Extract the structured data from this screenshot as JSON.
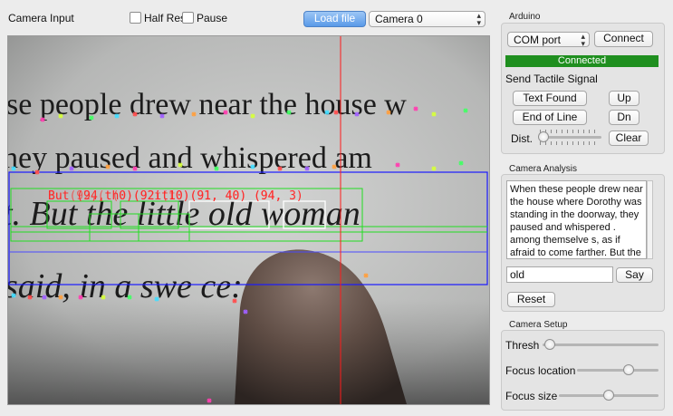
{
  "camera_input": {
    "title": "Camera Input",
    "half_res": "Half Res",
    "pause": "Pause",
    "load_file": "Load file",
    "camera_select": "Camera 0",
    "overlay": {
      "text_line_1": "But (94,th0)(92it10)(91, 40) (94, 3)",
      "text_line_2": "But(92,(t(0)(92t(t0)(91, 40)   (94,",
      "marker_colors": [
        "#ff3fb0",
        "#d6ff3c",
        "#44ff66",
        "#44ddff",
        "#ff4f4f",
        "#a060ff",
        "#ffa040"
      ]
    }
  },
  "arduino": {
    "title": "Arduino",
    "port_select": "COM port",
    "connect": "Connect",
    "status": "Connected",
    "status_color": "#1f8f1f",
    "send_label": "Send Tactile Signal",
    "text_found": "Text Found",
    "up": "Up",
    "end_of_line": "End of Line",
    "dn": "Dn",
    "dist_label": "Dist.",
    "dist_value": 0.0,
    "clear": "Clear"
  },
  "camera_analysis": {
    "title": "Camera Analysis",
    "text": "When these people drew near the house where Dorothy was standing in the doorway, they paused and whispered . among themselve s, as if afraid to come farther. But the little",
    "input_value": "old",
    "say": "Say",
    "reset": "Reset"
  },
  "camera_setup": {
    "title": "Camera Setup",
    "thresh_label": "Thresh",
    "thresh_value": 0.02,
    "focus_location_label": "Focus location",
    "focus_location_value": 0.65,
    "focus_size_label": "Focus size",
    "focus_size_value": 0.5
  }
}
